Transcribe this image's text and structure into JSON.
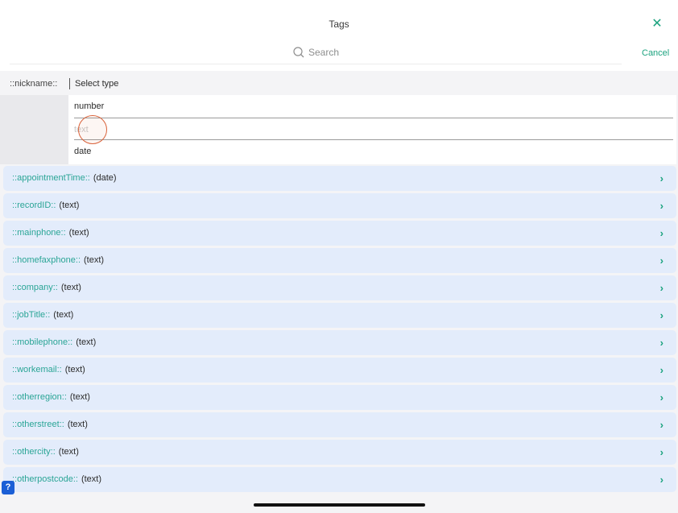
{
  "header": {
    "title": "Tags",
    "close_glyph": "✕",
    "cancel_label": "Cancel",
    "search": {
      "placeholder": "Search",
      "value": ""
    }
  },
  "editing_tag": {
    "name": "::nickname::",
    "type_label": "Select type"
  },
  "type_picker": {
    "options": [
      "number",
      "text",
      "date"
    ],
    "highlighted": "text"
  },
  "tags": [
    {
      "name": "::appointmentTime::",
      "type": "(date)"
    },
    {
      "name": "::recordID::",
      "type": "(text)"
    },
    {
      "name": "::mainphone::",
      "type": "(text)"
    },
    {
      "name": "::homefaxphone::",
      "type": "(text)"
    },
    {
      "name": "::company::",
      "type": "(text)"
    },
    {
      "name": "::jobTitle::",
      "type": "(text)"
    },
    {
      "name": "::mobilephone::",
      "type": "(text)"
    },
    {
      "name": "::workemail::",
      "type": "(text)"
    },
    {
      "name": "::otherregion::",
      "type": "(text)"
    },
    {
      "name": "::otherstreet::",
      "type": "(text)"
    },
    {
      "name": "::othercity::",
      "type": "(text)"
    },
    {
      "name": "::otherpostcode::",
      "type": "(text)"
    }
  ],
  "chevron_glyph": "›",
  "help_glyph": "?",
  "colors": {
    "accent": "#1ca37f",
    "tag_name": "#2aa596",
    "row_bg": "#e3ecfb",
    "tap_indicator": "#d9623a"
  }
}
